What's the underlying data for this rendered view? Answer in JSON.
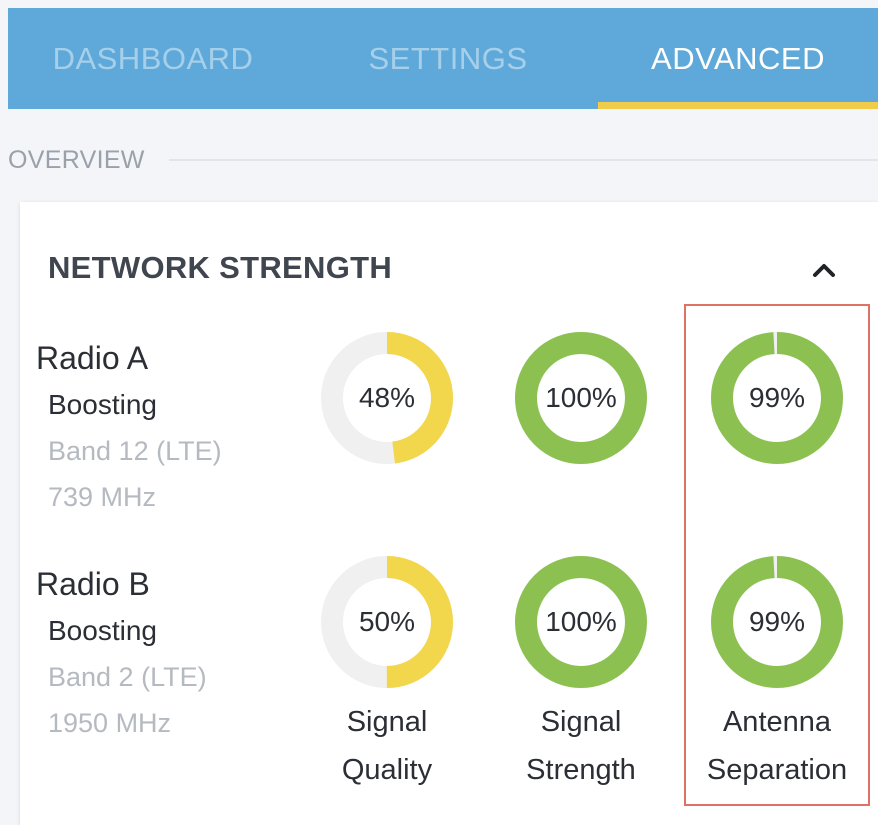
{
  "tabs": [
    {
      "label": "DASHBOARD",
      "active": false
    },
    {
      "label": "SETTINGS",
      "active": false
    },
    {
      "label": "ADVANCED",
      "active": true
    }
  ],
  "overview": {
    "label": "OVERVIEW"
  },
  "card": {
    "title": "NETWORK STRENGTH",
    "collapse_icon": "chevron-up-icon",
    "columns": [
      {
        "line1": "Signal",
        "line2": "Quality"
      },
      {
        "line1": "Signal",
        "line2": "Strength"
      },
      {
        "line1": "Antenna",
        "line2": "Separation"
      }
    ],
    "radios": [
      {
        "name": "Radio A",
        "status": "Boosting",
        "band": "Band 12 (LTE)",
        "frequency": "739 MHz",
        "metrics": [
          {
            "label": "48%",
            "value": 48,
            "color": "#f2d64b"
          },
          {
            "label": "100%",
            "value": 100,
            "color": "#8cc152"
          },
          {
            "label": "99%",
            "value": 99,
            "color": "#8cc152"
          }
        ]
      },
      {
        "name": "Radio B",
        "status": "Boosting",
        "band": "Band 2 (LTE)",
        "frequency": "1950 MHz",
        "metrics": [
          {
            "label": "50%",
            "value": 50,
            "color": "#f2d64b"
          },
          {
            "label": "100%",
            "value": 100,
            "color": "#8cc152"
          },
          {
            "label": "99%",
            "value": 99,
            "color": "#8cc152"
          }
        ]
      }
    ]
  },
  "colors": {
    "tab_bar": "#5ea9d9",
    "tab_indicator": "#f1cc4a",
    "ring_track": "#f0f0f0",
    "highlight": "#e07265"
  }
}
